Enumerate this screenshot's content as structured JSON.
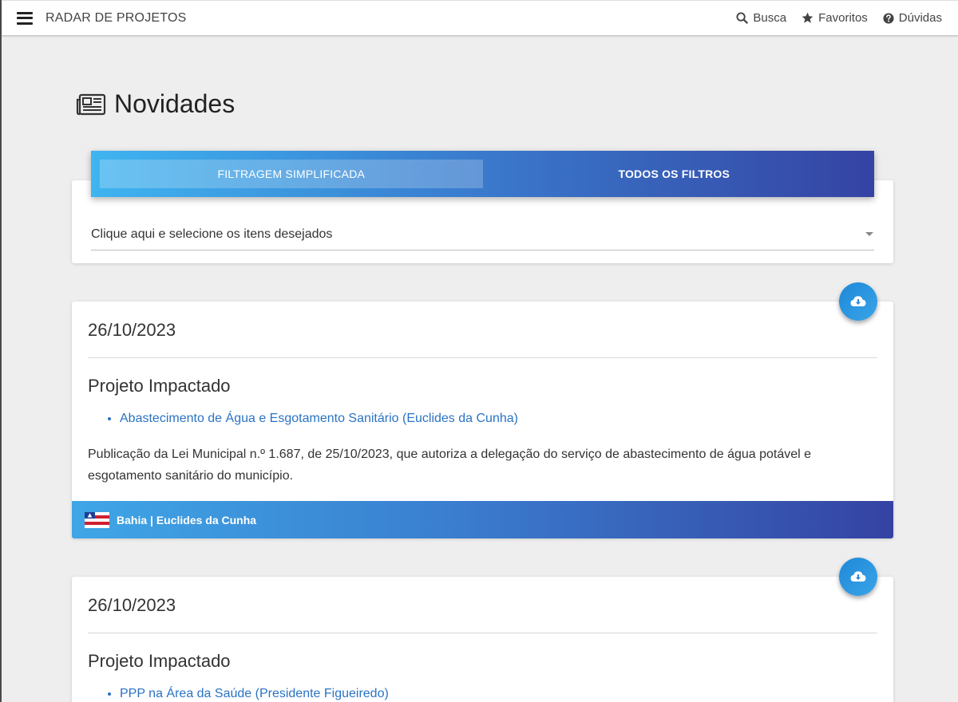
{
  "navbar": {
    "brand": "RADAR DE PROJETOS",
    "links": [
      {
        "label": "Busca",
        "icon": "search-icon"
      },
      {
        "label": "Favoritos",
        "icon": "star-icon"
      },
      {
        "label": "Dúvidas",
        "icon": "question-circle-icon"
      }
    ]
  },
  "page": {
    "title": "Novidades",
    "icon": "newspaper-icon"
  },
  "filter": {
    "tabs": [
      {
        "label": "FILTRAGEM SIMPLIFICADA",
        "active": true
      },
      {
        "label": "TODOS OS FILTROS",
        "active": false
      }
    ],
    "select_placeholder": "Clique aqui e selecione os itens desejados"
  },
  "news": [
    {
      "date": "26/10/2023",
      "heading": "Projeto Impactado",
      "projects": [
        "Abastecimento de Água e Esgotamento Sanitário (Euclides da Cunha)"
      ],
      "description": "Publicação da Lei Municipal n.º 1.687, de 25/10/2023, que autoriza a delegação do serviço de abastecimento de água potável e esgotamento sanitário do município.",
      "location": "Bahia | Euclides da Cunha"
    },
    {
      "date": "26/10/2023",
      "heading": "Projeto Impactado",
      "projects": [
        "PPP na Área da Saúde (Presidente Figueiredo)"
      ]
    }
  ],
  "colors": {
    "accent_start": "#3fb4f0",
    "accent_end": "#3543a3",
    "link": "#2a73c4",
    "background": "#eeeeee"
  }
}
